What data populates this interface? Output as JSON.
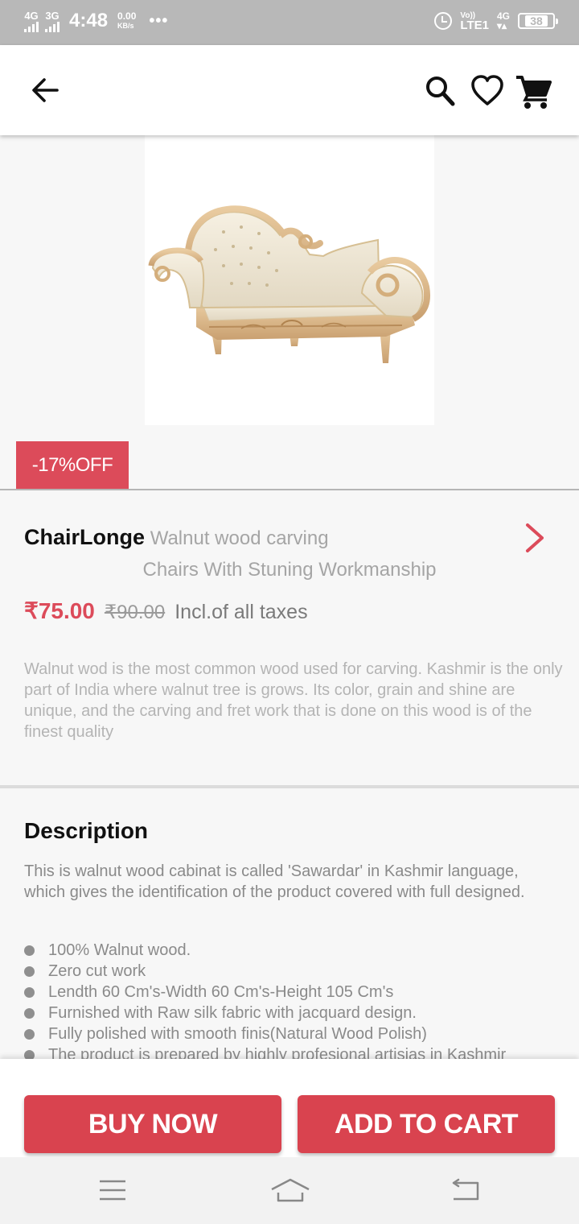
{
  "status_bar": {
    "net1": "4G",
    "net2": "3G",
    "time": "4:48",
    "speed_value": "0.00",
    "speed_unit": "KB/s",
    "dots": "•••",
    "volte_top": "Vo))",
    "volte_bottom": "LTE1",
    "net3": "4G",
    "battery": "38"
  },
  "app_bar": {
    "icons": [
      "back-arrow-icon",
      "search-icon",
      "heart-icon",
      "cart-icon"
    ]
  },
  "product": {
    "discount": "-17%OFF",
    "name": "ChairLonge",
    "subtitle_line1": "Walnut wood carving",
    "subtitle_line2": "Chairs With Stuning Workmanship",
    "price": "₹75.00",
    "old_price": "₹90.00",
    "tax_note": "Incl.of all taxes",
    "short_description": "Walnut wod is the most common wood used for carving. Kashmir is the only part of India where walnut tree is grows. Its color, grain and shine are unique, and the carving and fret work that is done on this wood is of the finest quality"
  },
  "description": {
    "heading": "Description",
    "body": "This is walnut wood cabinat is called 'Sawardar' in Kashmir language, which gives the identification of the product covered with full designed.",
    "features": [
      "100% Walnut wood.",
      "Zero cut work",
      "Lendth 60 Cm's-Width 60 Cm's-Height 105 Cm's",
      "Furnished with Raw silk fabric with jacquard design.",
      "Fully polished with smooth finis(Natural Wood Polish)",
      "The product is prepared by highly profesional artisias in Kashmir"
    ]
  },
  "actions": {
    "buy_now": "BUY NOW",
    "add_to_cart": "ADD TO CART"
  },
  "colors": {
    "accent": "#dc4b5a",
    "button": "#d9434f"
  }
}
